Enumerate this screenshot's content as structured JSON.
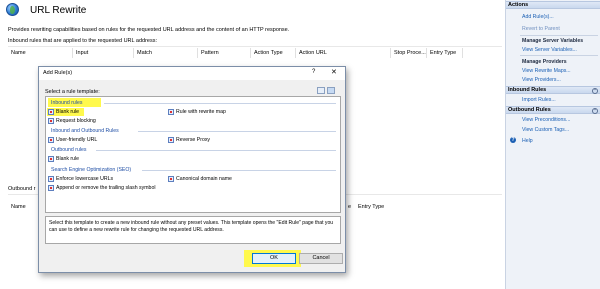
{
  "page": {
    "title": "URL Rewrite",
    "description": "Provides rewriting capabilities based on rules for the requested URL address and the content of an HTTP response.",
    "inbound_label": "Inbound rules that are applied to the requested URL address:",
    "outbound_label": "Outbound r",
    "columns": [
      "Name",
      "Input",
      "Match",
      "Pattern",
      "Action Type",
      "Action URL",
      "Stop Proce...",
      "Entry Type"
    ],
    "outbound_columns": [
      "Name",
      "e",
      "Entry Type"
    ]
  },
  "actions": {
    "header": "Actions",
    "items": [
      "Add Rule(s)...",
      "Revert to Parent"
    ],
    "manage_server_variables": "Manage Server Variables",
    "view_server_variables": "View Server Variables...",
    "manage_providers": "Manage Providers",
    "view_rewrite_maps": "View Rewrite Maps...",
    "view_providers": "View Providers...",
    "inbound_header": "Inbound Rules",
    "import_rules": "Import Rules...",
    "outbound_header": "Outbound Rules",
    "view_preconditions": "View Preconditions...",
    "view_custom_tags": "View Custom Tags...",
    "help": "Help"
  },
  "dialog": {
    "title": "Add Rule(s)",
    "help": "?",
    "close": "✕",
    "select_label": "Select a rule template:",
    "groups": {
      "inbound": "Inbound rules",
      "inbound_outbound": "Inbound and Outbound Rules",
      "outbound": "Outbound rules",
      "seo": "Search Engine Optimization (SEO)"
    },
    "items": {
      "blank_rule": "Blank rule",
      "rule_with_rewrite_map": "Rule with rewrite map",
      "request_blocking": "Request blocking",
      "user_friendly_url": "User-friendly URL",
      "reverse_proxy": "Reverse Proxy",
      "outbound_blank_rule": "Blank rule",
      "enforce_lowercase": "Enforce lowercase URLs",
      "canonical_domain": "Canonical domain name",
      "trailing_slash": "Append or remove the trailing slash symbol"
    },
    "description": "Select this template to create a new inbound rule without any preset values. This template opens the \"Edit Rule\" page that you can use to define a new rewrite rule for changing the requested URL address.",
    "ok": "OK",
    "cancel": "Cancel"
  }
}
